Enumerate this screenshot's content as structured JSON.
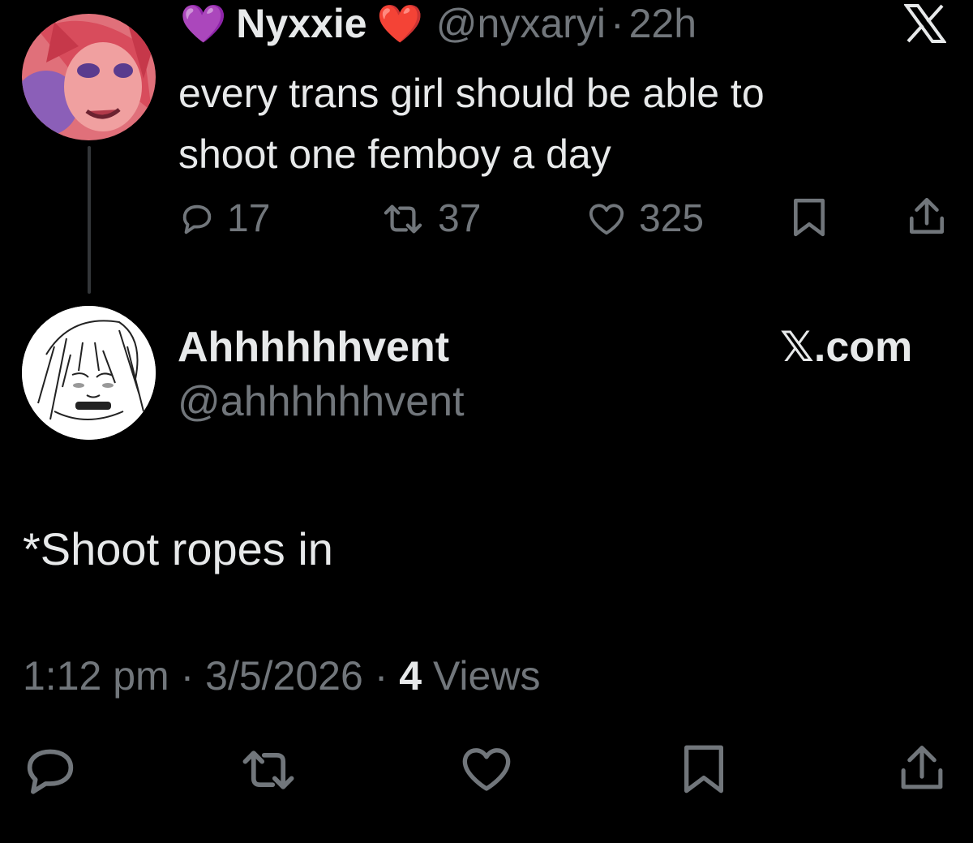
{
  "quoted_tweet": {
    "prefix_emoji": "💜",
    "display_name": "Nyxxie",
    "suffix_emoji": "❤️",
    "handle": "@nyxaryi",
    "separator": "·",
    "age": "22h",
    "text_line1": "every trans girl should be able to",
    "text_line2": "shoot one femboy a day",
    "replies": "17",
    "reposts": "37",
    "likes": "325",
    "icons": {
      "logo": "x-logo-icon",
      "reply": "reply-icon",
      "repost": "repost-icon",
      "like": "heart-icon",
      "bookmark": "bookmark-icon",
      "share": "share-icon"
    }
  },
  "reply_tweet": {
    "display_name": "Ahhhhhhvent",
    "handle": "@ahhhhhhvent",
    "source_label": "𝕏.com",
    "text": "*Shoot ropes in",
    "time": "1:12 pm",
    "separator": "·",
    "date": "3/5/2026",
    "views_count": "4",
    "views_label": "Views",
    "icons": {
      "reply": "reply-icon",
      "repost": "repost-icon",
      "like": "heart-icon",
      "bookmark": "bookmark-icon",
      "share": "share-icon"
    }
  },
  "colors": {
    "background": "#000000",
    "text": "#e7e9ea",
    "muted": "#71767b",
    "line": "#333639"
  }
}
